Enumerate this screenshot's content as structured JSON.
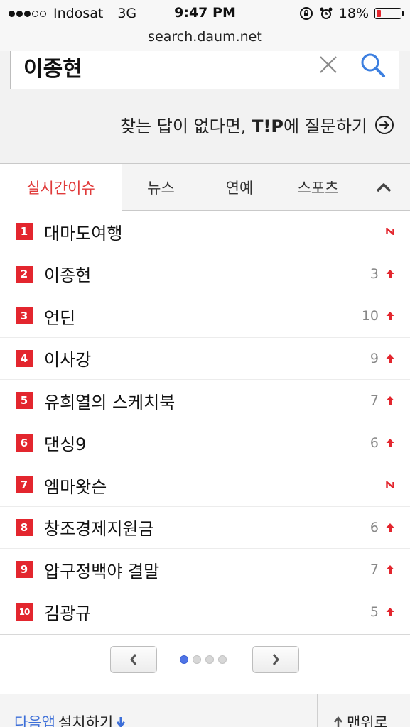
{
  "status_bar": {
    "carrier": "Indosat",
    "network": "3G",
    "time": "9:47 PM",
    "battery": "18%",
    "battery_level": 0.18
  },
  "url": "search.daum.net",
  "search": {
    "query": "이종현"
  },
  "tip_link": {
    "prefix": "찾는 답이 없다면,",
    "brand": "T!P",
    "suffix": "에 질문하기"
  },
  "tabs": [
    {
      "label": "실시간이슈",
      "active": true
    },
    {
      "label": "뉴스"
    },
    {
      "label": "연예"
    },
    {
      "label": "스포츠"
    }
  ],
  "ranking": [
    {
      "rank": "1",
      "keyword": "대마도여행",
      "change": "",
      "status": "new"
    },
    {
      "rank": "2",
      "keyword": "이종현",
      "change": "3",
      "status": "up"
    },
    {
      "rank": "3",
      "keyword": "언딘",
      "change": "10",
      "status": "up"
    },
    {
      "rank": "4",
      "keyword": "이사강",
      "change": "9",
      "status": "up"
    },
    {
      "rank": "5",
      "keyword": "유희열의 스케치북",
      "change": "7",
      "status": "up"
    },
    {
      "rank": "6",
      "keyword": "댄싱9",
      "change": "6",
      "status": "up"
    },
    {
      "rank": "7",
      "keyword": "엠마왓슨",
      "change": "",
      "status": "new"
    },
    {
      "rank": "8",
      "keyword": "창조경제지원금",
      "change": "6",
      "status": "up"
    },
    {
      "rank": "9",
      "keyword": "압구정백야 결말",
      "change": "7",
      "status": "up"
    },
    {
      "rank": "10",
      "keyword": "김광규",
      "change": "5",
      "status": "up"
    }
  ],
  "pager": {
    "pages": 4,
    "current": 1
  },
  "footer": {
    "app_brand": "다음앱",
    "app_action": "설치하기",
    "to_top": "맨위로"
  },
  "colors": {
    "accent_red": "#e3262e",
    "link_blue": "#3d6fd8",
    "active_dot": "#4f74e6"
  }
}
